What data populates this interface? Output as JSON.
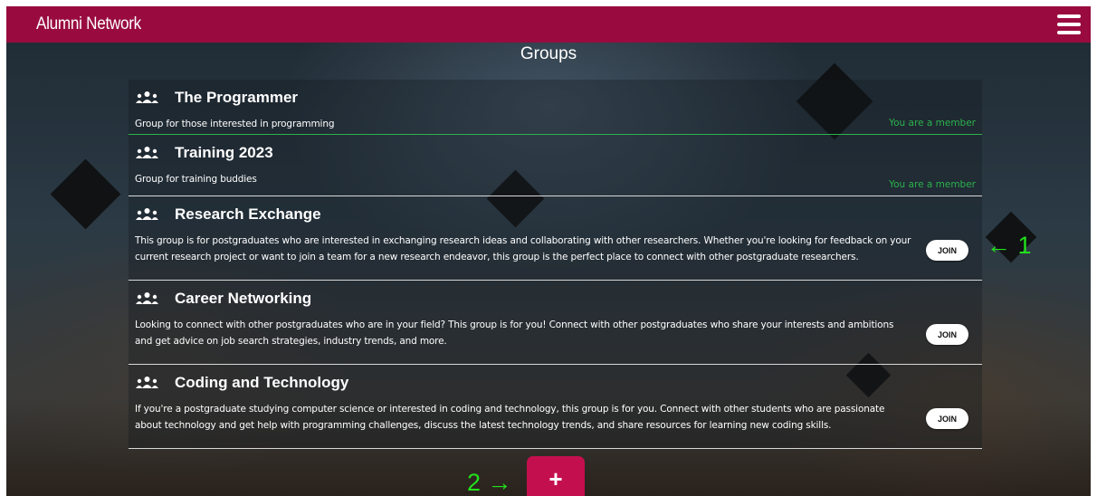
{
  "navbar": {
    "brand": "Alumni Network",
    "menu_icon": "hamburger-menu-icon",
    "background": "#990b3f"
  },
  "page": {
    "title": "Groups"
  },
  "groups": [
    {
      "name": "The Programmer",
      "description": "Group for those interested in programming",
      "status": "You are a member",
      "icon": "users-icon"
    },
    {
      "name": "Training 2023",
      "description": "Group for training buddies",
      "status": "You are a member",
      "icon": "users-icon"
    },
    {
      "name": "Research Exchange",
      "description": "This group is for postgraduates who are interested in exchanging research ideas and collaborating with other researchers. Whether you're looking for feedback on your current research project or want to join a team for a new research endeavor, this group is the perfect place to connect with other postgraduate researchers.",
      "action": "JOIN",
      "icon": "users-icon"
    },
    {
      "name": "Career Networking",
      "description": "Looking to connect with other postgraduates who are in your field? This group is for you! Connect with other postgraduates who share your interests and ambitions and get advice on job search strategies, industry trends, and more.",
      "action": "JOIN",
      "icon": "users-icon"
    },
    {
      "name": "Coding and Technology",
      "description": "If you're a postgraduate studying computer science or interested in coding and technology, this group is for you. Connect with other students who are passionate about technology and get help with programming challenges, discuss the latest technology trends, and share resources for learning new coding skills.",
      "action": "JOIN",
      "icon": "users-icon"
    }
  ],
  "annotations": {
    "one": "← 1",
    "two": "2 →"
  },
  "add_button": {
    "label": "+"
  },
  "colors": {
    "accent": "#990b3f",
    "add_button": "#c40f4e",
    "member_status": "#2bb24c",
    "annotation": "#22e01b"
  }
}
